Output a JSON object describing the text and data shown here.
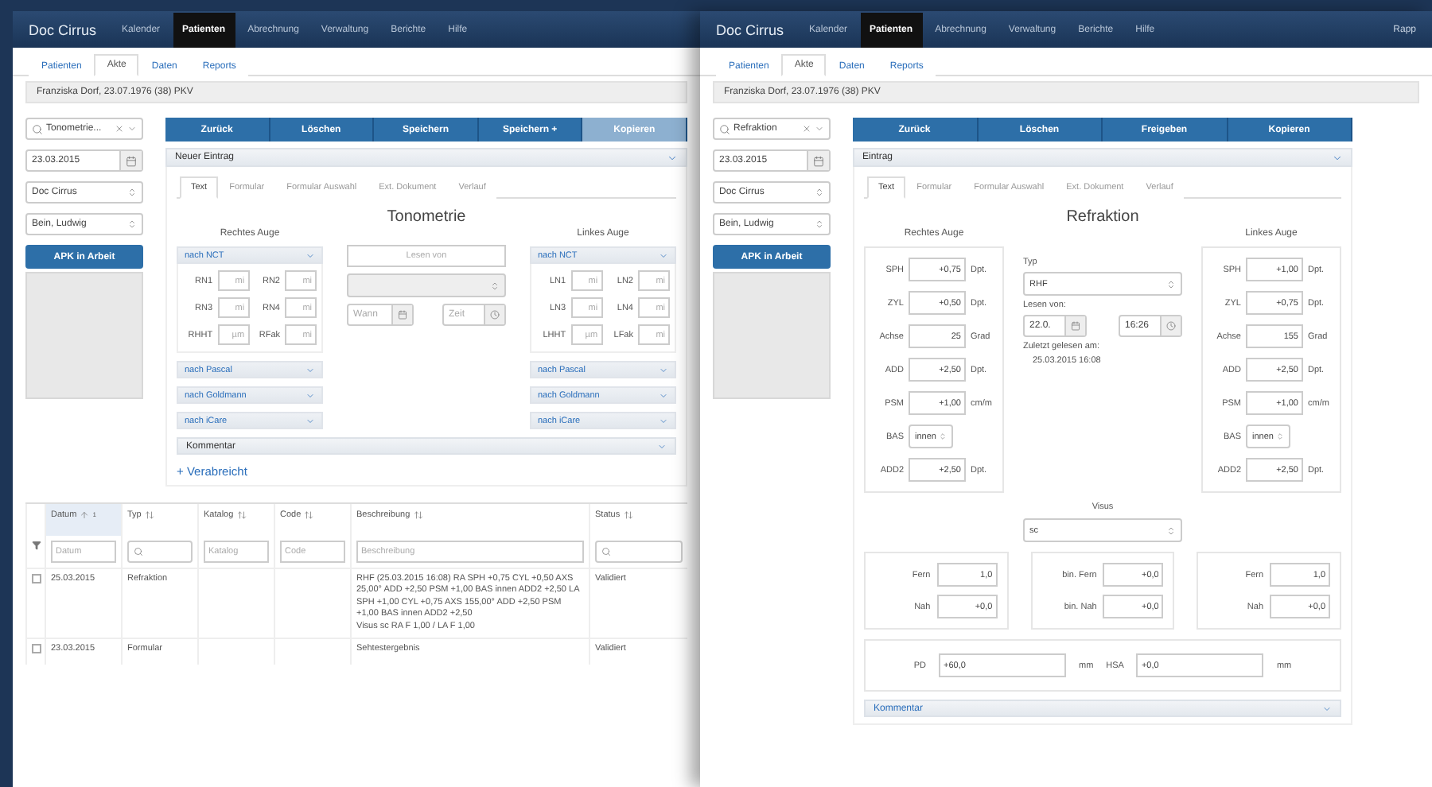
{
  "tonometry_window": {
    "nav": {
      "brand": "Doc Cirrus",
      "items": [
        {
          "label": "Kalender",
          "selected": false
        },
        {
          "label": "Patienten",
          "selected": true
        },
        {
          "label": "Abrechnung",
          "selected": false
        },
        {
          "label": "Verwaltung",
          "selected": false
        },
        {
          "label": "Berichte",
          "selected": false
        },
        {
          "label": "Hilfe",
          "selected": false
        }
      ]
    },
    "subnav": [
      {
        "label": "Patienten",
        "selected": false
      },
      {
        "label": "Akte",
        "selected": true
      },
      {
        "label": "Daten",
        "selected": false
      },
      {
        "label": "Reports",
        "selected": false
      }
    ],
    "patient": "Franziska Dorf, 23.07.1976 (38) PKV",
    "sidebar": {
      "search": "Tonometrie...",
      "date": "23.03.2015",
      "selects": [
        "Doc Cirrus",
        "Bein, Ludwig"
      ],
      "button": "APK in Arbeit"
    },
    "toolbar": [
      {
        "label": "Zurück",
        "disabled": false
      },
      {
        "label": "Löschen",
        "disabled": false
      },
      {
        "label": "Speichern",
        "disabled": false
      },
      {
        "label": "Speichern +",
        "disabled": false
      },
      {
        "label": "Kopieren",
        "disabled": true
      }
    ],
    "panel": {
      "title": "Neuer Eintrag",
      "tabs": [
        {
          "label": "Text",
          "selected": true
        },
        {
          "label": "Formular",
          "selected": false
        },
        {
          "label": "Formular Auswahl",
          "selected": false
        },
        {
          "label": "Ext. Dokument",
          "selected": false
        },
        {
          "label": "Verlauf",
          "selected": false
        }
      ],
      "heading": "Tonometrie",
      "eyes": [
        {
          "label": "Rechtes Auge",
          "sections": [
            {
              "title": "nach NCT",
              "expanded": true,
              "fields": [
                {
                  "label": "RN1",
                  "placeholder": "mi"
                },
                {
                  "label": "RN2",
                  "placeholder": "mi"
                },
                {
                  "label": "RN3",
                  "placeholder": "mi"
                },
                {
                  "label": "RN4",
                  "placeholder": "mi"
                },
                {
                  "label": "RHHT",
                  "placeholder": "µm"
                },
                {
                  "label": "RFak",
                  "placeholder": "mi"
                }
              ]
            },
            {
              "title": "nach Pascal",
              "expanded": false
            },
            {
              "title": "nach Goldmann",
              "expanded": false
            },
            {
              "title": "nach iCare",
              "expanded": false
            }
          ]
        },
        {
          "label": "Linkes Auge",
          "sections": [
            {
              "title": "nach NCT",
              "expanded": true,
              "fields": [
                {
                  "label": "LN1",
                  "placeholder": "mi"
                },
                {
                  "label": "LN2",
                  "placeholder": "mi"
                },
                {
                  "label": "LN3",
                  "placeholder": "mi"
                },
                {
                  "label": "LN4",
                  "placeholder": "mi"
                },
                {
                  "label": "LHHT",
                  "placeholder": "µm"
                },
                {
                  "label": "LFak",
                  "placeholder": "mi"
                }
              ]
            },
            {
              "title": "nach Pascal",
              "expanded": false
            },
            {
              "title": "nach Goldmann",
              "expanded": false
            },
            {
              "title": "nach iCare",
              "expanded": false
            }
          ]
        }
      ],
      "center": {
        "read_from": {
          "placeholder": "Lesen von"
        },
        "date": {
          "placeholder": "Wann"
        },
        "time": {
          "placeholder": "Zeit"
        }
      },
      "comment": "Kommentar",
      "add_link": "+ Verabreicht"
    },
    "table": {
      "columns": [
        {
          "label": "Datum",
          "sorted": true,
          "sort_order": "1"
        },
        {
          "label": "Typ",
          "sorted": false
        },
        {
          "label": "Katalog",
          "sorted": false
        },
        {
          "label": "Code",
          "sorted": false
        },
        {
          "label": "Beschreibung",
          "sorted": false
        },
        {
          "label": "Status",
          "sorted": false
        }
      ],
      "filters": [
        {
          "kind": "text",
          "placeholder": "Datum"
        },
        {
          "kind": "search"
        },
        {
          "kind": "text",
          "placeholder": "Katalog"
        },
        {
          "kind": "text",
          "placeholder": "Code"
        },
        {
          "kind": "text",
          "placeholder": "Beschreibung"
        },
        {
          "kind": "search"
        }
      ],
      "rows": [
        {
          "selected": false,
          "cells": [
            "25.03.2015",
            "Refraktion",
            "",
            ""
          ],
          "description": [
            "RHF (25.03.2015 16:08) RA SPH +0,75 CYL +0,50 AXS 25,00° ADD +2,50 PSM +1,00 BAS innen ADD2 +2,50 LA SPH +1,00 CYL +0,75 AXS 155,00° ADD +2,50 PSM +1,00 BAS innen ADD2 +2,50",
            "Visus sc RA F 1,00 / LA F 1,00"
          ],
          "status": "Validiert"
        },
        {
          "selected": false,
          "cells": [
            "23.03.2015",
            "Formular",
            "",
            ""
          ],
          "description": [
            "Sehtestergebnis"
          ],
          "status": "Validiert"
        }
      ]
    }
  },
  "refraction_window": {
    "nav": {
      "brand": "Doc Cirrus",
      "items": [
        {
          "label": "Kalender",
          "selected": false
        },
        {
          "label": "Patienten",
          "selected": true
        },
        {
          "label": "Abrechnung",
          "selected": false
        },
        {
          "label": "Verwaltung",
          "selected": false
        },
        {
          "label": "Berichte",
          "selected": false
        },
        {
          "label": "Hilfe",
          "selected": false
        }
      ],
      "extra": "Rapp"
    },
    "subnav": [
      {
        "label": "Patienten",
        "selected": false
      },
      {
        "label": "Akte",
        "selected": true
      },
      {
        "label": "Daten",
        "selected": false
      },
      {
        "label": "Reports",
        "selected": false
      }
    ],
    "patient": "Franziska Dorf, 23.07.1976 (38) PKV",
    "sidebar": {
      "search": "Refraktion",
      "date": "23.03.2015",
      "selects": [
        "Doc Cirrus",
        "Bein, Ludwig"
      ],
      "button": "APK in Arbeit"
    },
    "toolbar": [
      {
        "label": "Zurück",
        "disabled": false
      },
      {
        "label": "Löschen",
        "disabled": false
      },
      {
        "label": "Freigeben",
        "disabled": false
      },
      {
        "label": "Kopieren",
        "disabled": false
      }
    ],
    "panel": {
      "title": "Eintrag",
      "tabs": [
        {
          "label": "Text",
          "selected": true
        },
        {
          "label": "Formular",
          "selected": false
        },
        {
          "label": "Formular Auswahl",
          "selected": false
        },
        {
          "label": "Ext. Dokument",
          "selected": false
        },
        {
          "label": "Verlauf",
          "selected": false
        }
      ],
      "heading": "Refraktion",
      "eyes": [
        {
          "label": "Rechtes Auge",
          "fields": [
            {
              "kind": "input",
              "label": "SPH",
              "value": "+0,75",
              "unit": "Dpt."
            },
            {
              "kind": "input",
              "label": "ZYL",
              "value": "+0,50",
              "unit": "Dpt."
            },
            {
              "kind": "input",
              "label": "Achse",
              "value": "25",
              "unit": "Grad"
            },
            {
              "kind": "input",
              "label": "ADD",
              "value": "+2,50",
              "unit": "Dpt."
            },
            {
              "kind": "input",
              "label": "PSM",
              "value": "+1,00",
              "unit": "cm/m"
            },
            {
              "kind": "select",
              "label": "BAS",
              "value": "innen"
            },
            {
              "kind": "input",
              "label": "ADD2",
              "value": "+2,50",
              "unit": "Dpt."
            }
          ]
        },
        {
          "label": "Linkes Auge",
          "fields": [
            {
              "kind": "input",
              "label": "SPH",
              "value": "+1,00",
              "unit": "Dpt."
            },
            {
              "kind": "input",
              "label": "ZYL",
              "value": "+0,75",
              "unit": "Dpt."
            },
            {
              "kind": "input",
              "label": "Achse",
              "value": "155",
              "unit": "Grad"
            },
            {
              "kind": "input",
              "label": "ADD",
              "value": "+2,50",
              "unit": "Dpt."
            },
            {
              "kind": "input",
              "label": "PSM",
              "value": "+1,00",
              "unit": "cm/m"
            },
            {
              "kind": "select",
              "label": "BAS",
              "value": "innen"
            },
            {
              "kind": "input",
              "label": "ADD2",
              "value": "+2,50",
              "unit": "Dpt."
            }
          ]
        }
      ],
      "center": {
        "type_label": "Typ",
        "type_value": "RHF",
        "read_label": "Lesen von:",
        "read_date": "22.0.",
        "read_time": "16:26",
        "last_read_label": "Zuletzt gelesen am:",
        "last_read_value": "25.03.2015 16:08"
      },
      "visus": {
        "label": "Visus",
        "value": "sc",
        "boxes": [
          [
            {
              "label": "Fern",
              "value": "1,0"
            },
            {
              "label": "Nah",
              "value": "+0,0"
            }
          ],
          [
            {
              "label": "bin. Fern",
              "value": "+0,0"
            },
            {
              "label": "bin. Nah",
              "value": "+0,0"
            }
          ],
          [
            {
              "label": "Fern",
              "value": "1,0"
            },
            {
              "label": "Nah",
              "value": "+0,0"
            }
          ]
        ]
      },
      "measures": [
        {
          "label": "PD",
          "value": "+60,0",
          "unit": "mm"
        },
        {
          "label": "HSA",
          "value": "+0,0",
          "unit": "mm"
        }
      ],
      "comment": "Kommentar"
    }
  }
}
